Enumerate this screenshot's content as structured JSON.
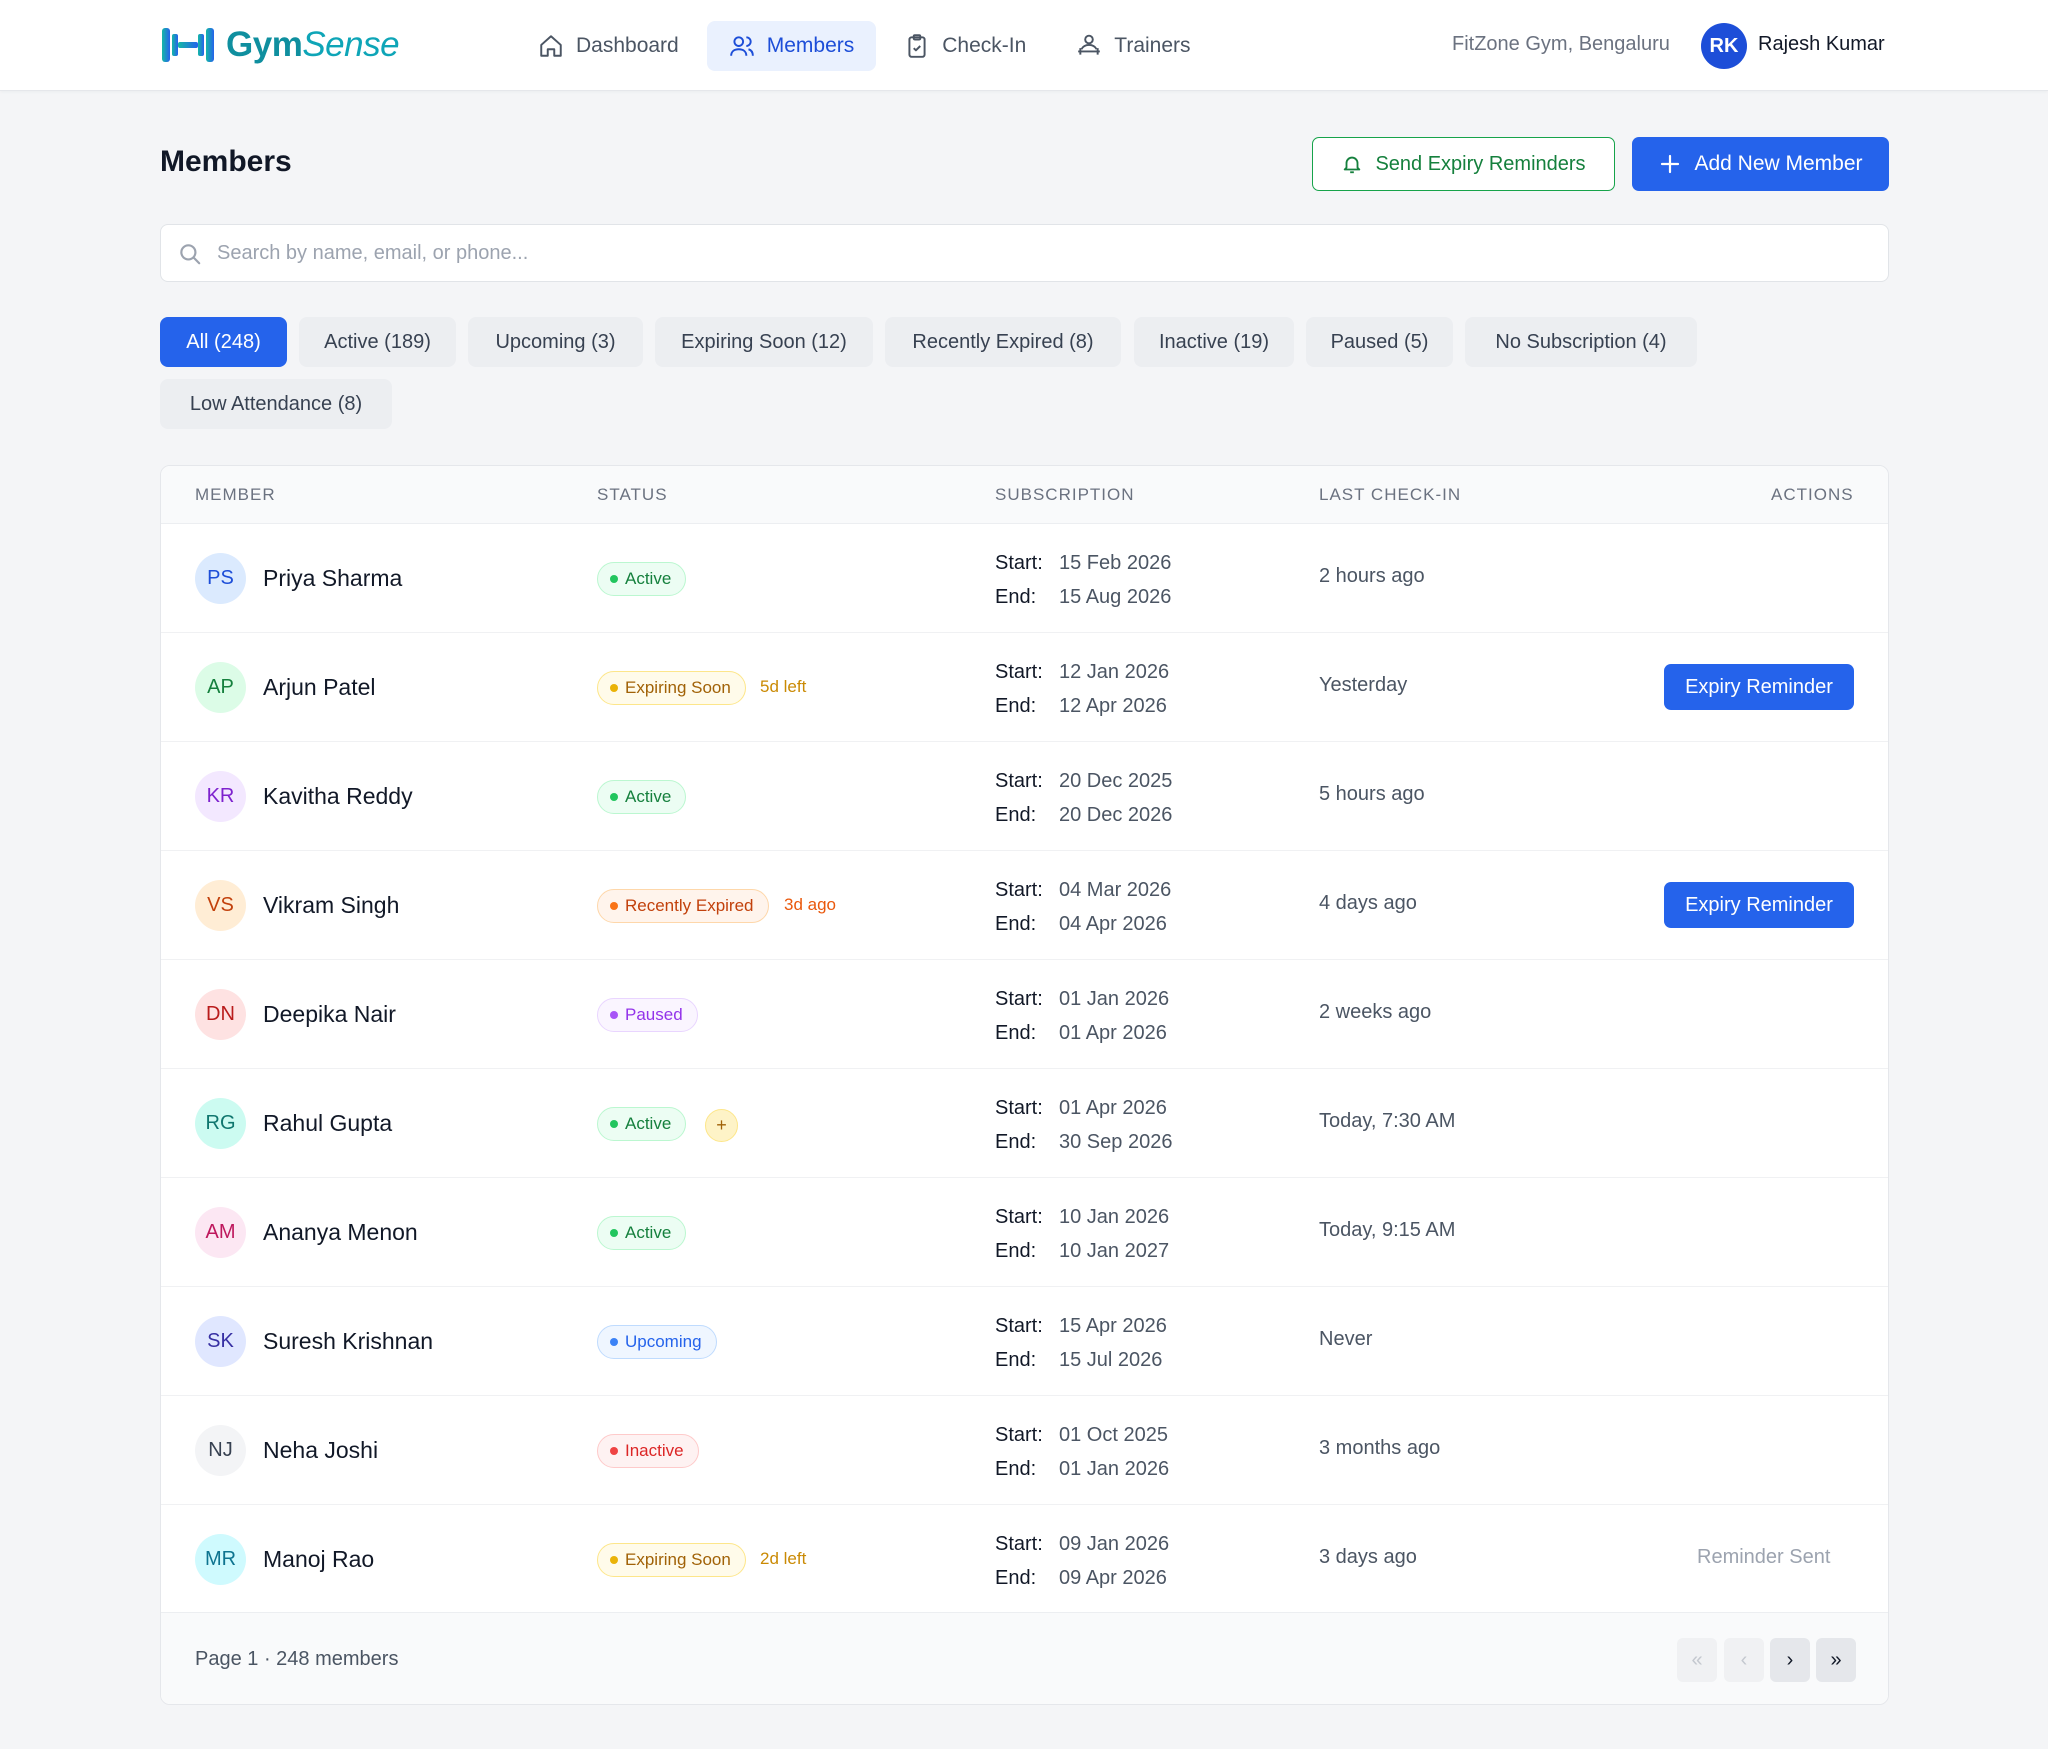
{
  "app": {
    "logo_gym": "Gym",
    "logo_sense": "Sense",
    "nav": [
      {
        "label": "Dashboard",
        "icon": "home-icon"
      },
      {
        "label": "Members",
        "icon": "users-icon",
        "active": true
      },
      {
        "label": "Check-In",
        "icon": "clipboard-check-icon"
      },
      {
        "label": "Trainers",
        "icon": "trainer-icon"
      }
    ],
    "gym_name": "FitZone Gym, Bengaluru",
    "user_initials": "RK",
    "user_name": "Rajesh Kumar"
  },
  "page": {
    "title": "Members",
    "send_reminders_label": "Send Expiry Reminders",
    "add_member_label": "Add New Member",
    "search_placeholder": "Search by name, email, or phone..."
  },
  "filters": [
    "All (248)",
    "Active (189)",
    "Upcoming (3)",
    "Expiring Soon (12)",
    "Recently Expired (8)",
    "Inactive (19)",
    "Paused (5)",
    "No Subscription (4)",
    "Low Attendance (8)"
  ],
  "table": {
    "headers": {
      "member": "MEMBER",
      "status": "STATUS",
      "subscription": "SUBSCRIPTION",
      "last_checkin": "LAST CHECK-IN",
      "actions": "ACTIONS"
    },
    "start_label": "Start:",
    "end_label": "End:",
    "rows": [
      {
        "initials": "PS",
        "name": "Priya Sharma",
        "status": "Active",
        "note": "",
        "start": "15 Feb 2026",
        "end": "15 Aug 2026",
        "checkin": "2 hours ago",
        "action": ""
      },
      {
        "initials": "AP",
        "name": "Arjun Patel",
        "status": "Expiring Soon",
        "note": "5d left",
        "start": "12 Jan 2026",
        "end": "12 Apr 2026",
        "checkin": "Yesterday",
        "action": "Expiry Reminder"
      },
      {
        "initials": "KR",
        "name": "Kavitha Reddy",
        "status": "Active",
        "note": "",
        "start": "20 Dec 2025",
        "end": "20 Dec 2026",
        "checkin": "5 hours ago",
        "action": ""
      },
      {
        "initials": "VS",
        "name": "Vikram Singh",
        "status": "Recently Expired",
        "note": "3d ago",
        "start": "04 Mar 2026",
        "end": "04 Apr 2026",
        "checkin": "4 days ago",
        "action": "Expiry Reminder"
      },
      {
        "initials": "DN",
        "name": "Deepika Nair",
        "status": "Paused",
        "note": "",
        "start": "01 Jan 2026",
        "end": "01 Apr 2026",
        "checkin": "2 weeks ago",
        "action": ""
      },
      {
        "initials": "RG",
        "name": "Rahul Gupta",
        "status": "Active",
        "note": "+",
        "start": "01 Apr 2026",
        "end": "30 Sep 2026",
        "checkin": "Today, 7:30 AM",
        "action": ""
      },
      {
        "initials": "AM",
        "name": "Ananya Menon",
        "status": "Active",
        "note": "",
        "start": "10 Jan 2026",
        "end": "10 Jan 2027",
        "checkin": "Today, 9:15 AM",
        "action": ""
      },
      {
        "initials": "SK",
        "name": "Suresh Krishnan",
        "status": "Upcoming",
        "note": "",
        "start": "15 Apr 2026",
        "end": "15 Jul 2026",
        "checkin": "Never",
        "action": ""
      },
      {
        "initials": "NJ",
        "name": "Neha Joshi",
        "status": "Inactive",
        "note": "",
        "start": "01 Oct 2025",
        "end": "01 Jan 2026",
        "checkin": "3 months ago",
        "action": ""
      },
      {
        "initials": "MR",
        "name": "Manoj Rao",
        "status": "Expiring Soon",
        "note": "2d left",
        "start": "09 Jan 2026",
        "end": "09 Apr 2026",
        "checkin": "3 days ago",
        "action": "Reminder Sent"
      }
    ]
  },
  "footer": {
    "page_info": "Page 1 · 248 members",
    "first": "«",
    "prev": "‹",
    "next": "›",
    "last": "»"
  },
  "colors": {
    "primary": "#2563eb",
    "success": "#16a34a",
    "brand": "#0ea5b7"
  }
}
